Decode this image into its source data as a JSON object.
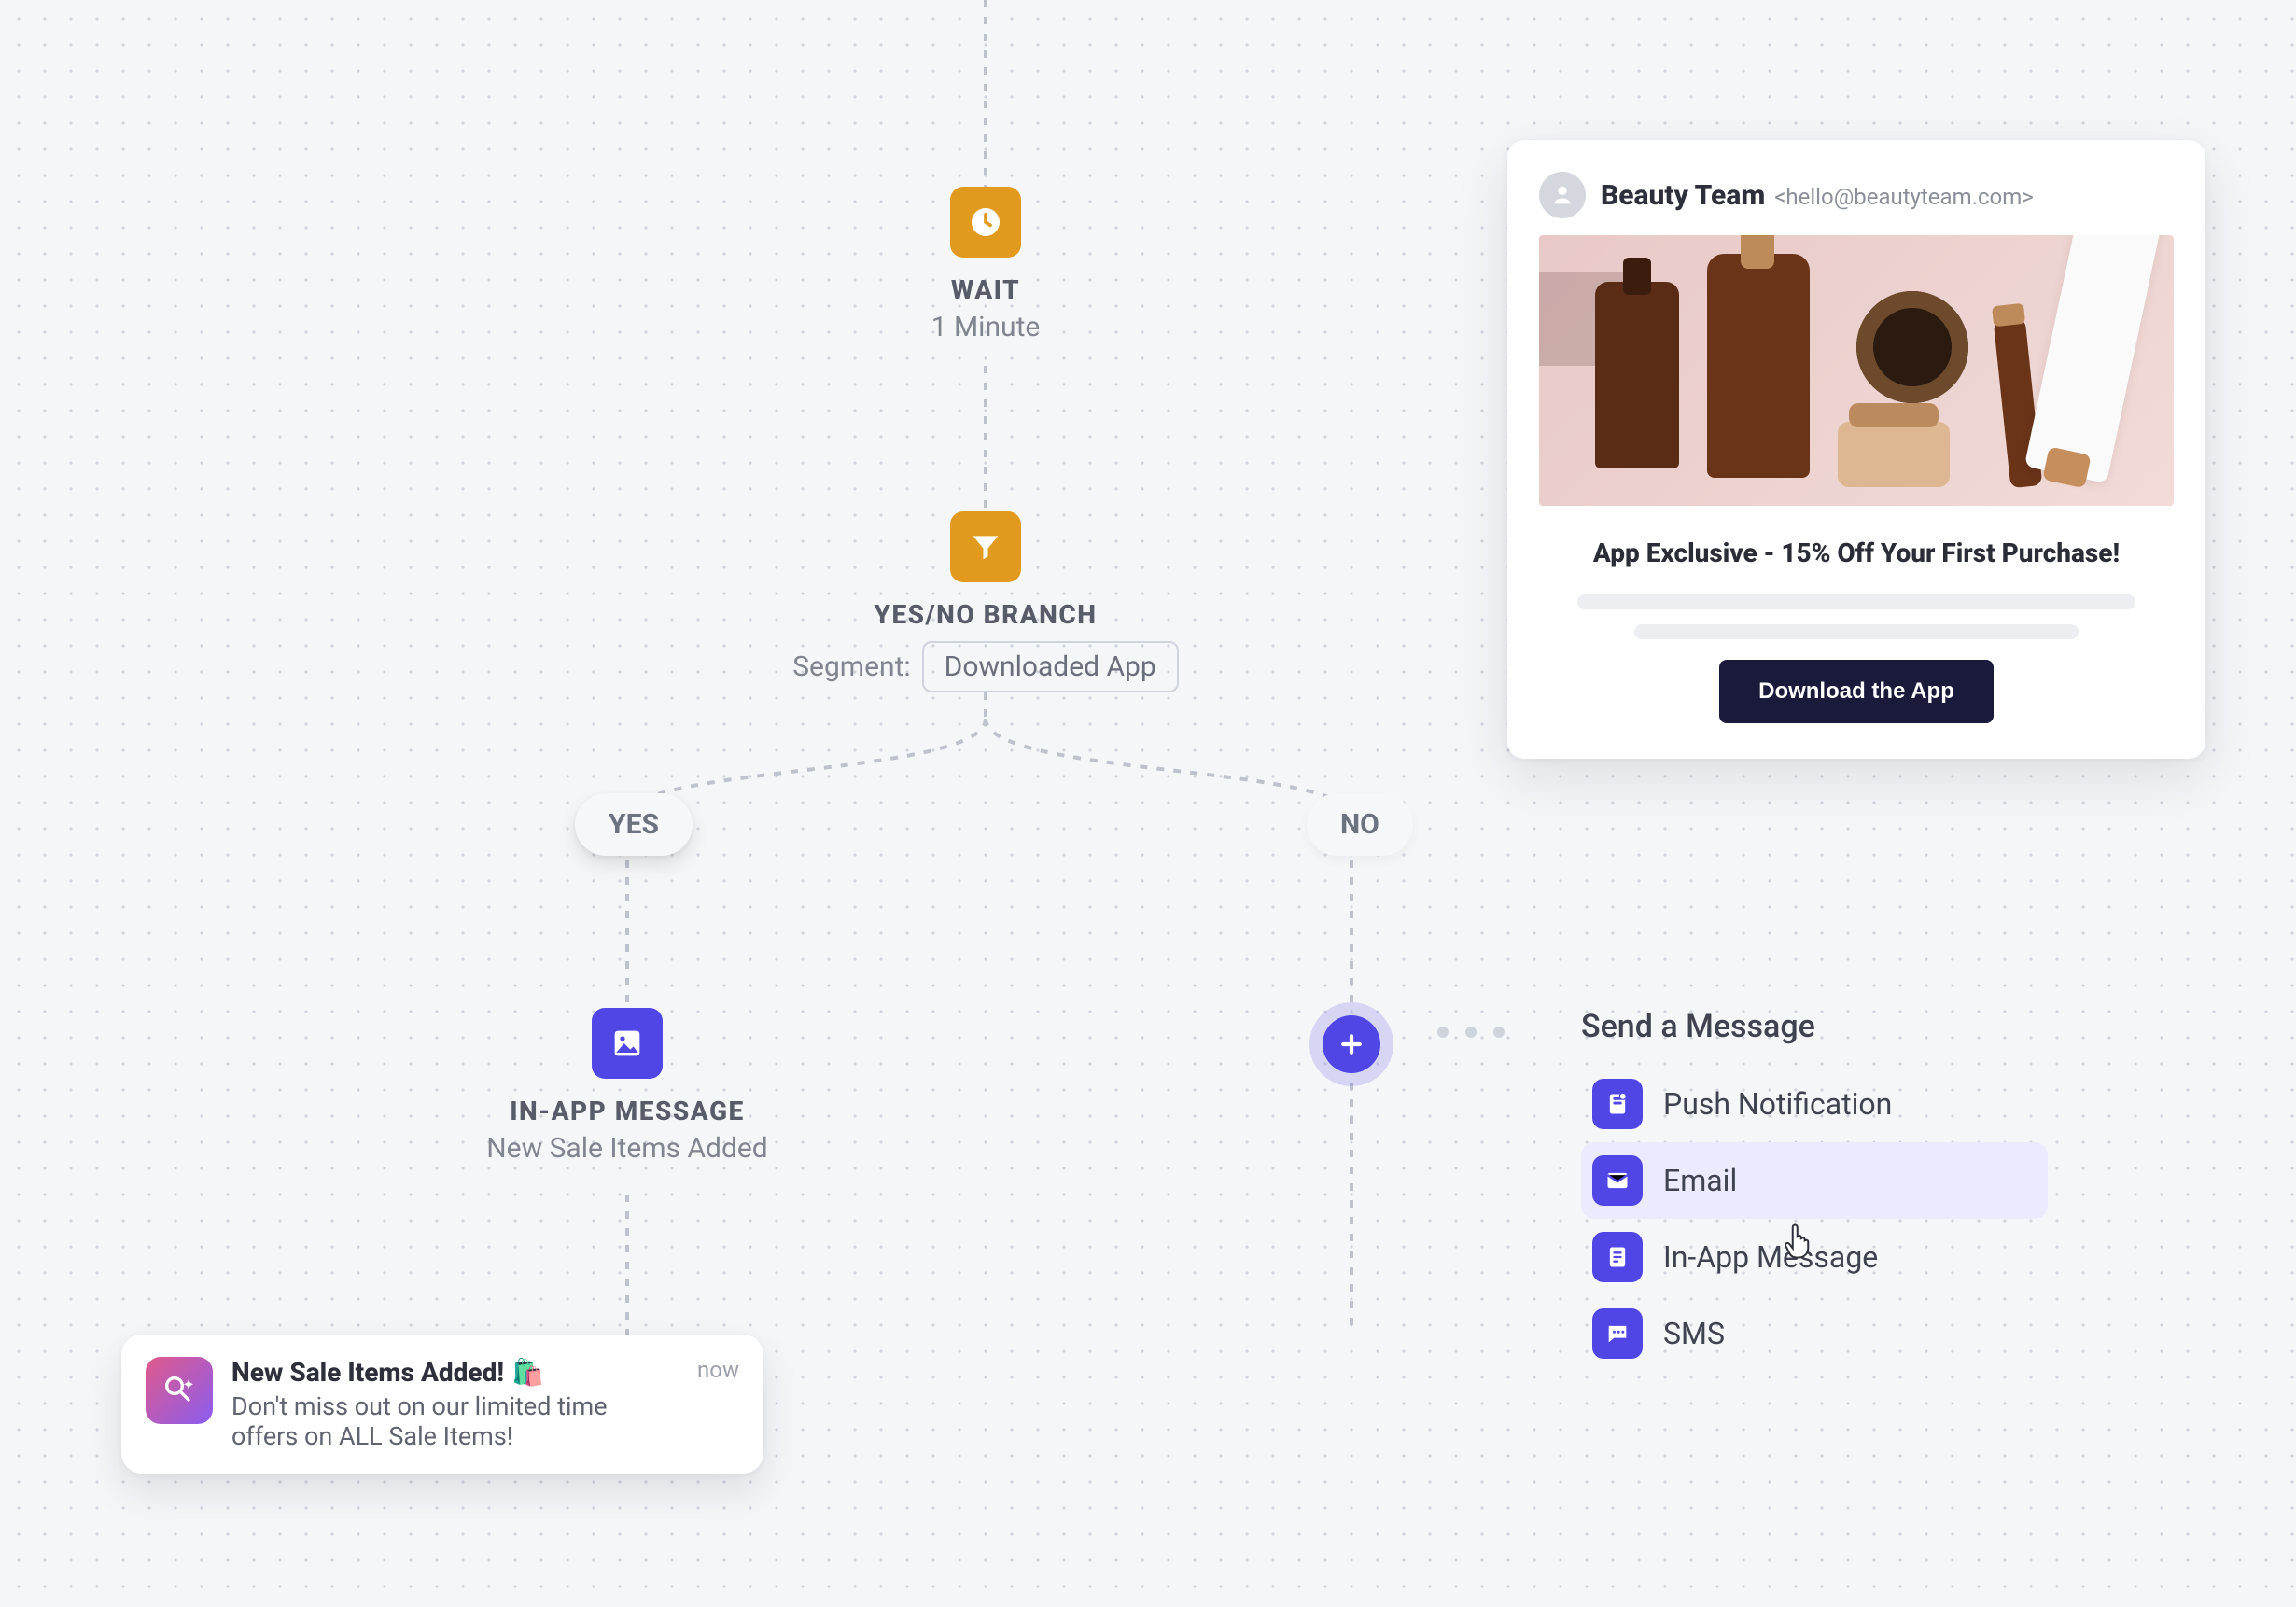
{
  "nodes": {
    "wait": {
      "title": "WAIT",
      "sub": "1 Minute"
    },
    "branch": {
      "title": "YES/NO BRANCH",
      "segment_label": "Segment:",
      "segment_value": "Downloaded App"
    },
    "inapp": {
      "title": "IN-APP MESSAGE",
      "sub": "New Sale Items Added"
    }
  },
  "pills": {
    "yes": "YES",
    "no": "NO"
  },
  "email_preview": {
    "from_name": "Beauty Team",
    "from_addr": "<hello@beautyteam.com>",
    "headline": "App Exclusive - 15% Off Your First Purchase!",
    "cta": "Download the App"
  },
  "menu": {
    "title": "Send a Message",
    "items": [
      {
        "label": "Push Notification",
        "icon": "bell-icon"
      },
      {
        "label": "Email",
        "icon": "mail-icon"
      },
      {
        "label": "In-App Message",
        "icon": "doc-icon"
      },
      {
        "label": "SMS",
        "icon": "chat-icon"
      }
    ],
    "hovered_index": 1
  },
  "toast": {
    "title": "New Sale Items Added!",
    "emoji": "🛍️",
    "body": "Don't miss out on our limited time offers on ALL Sale Items!",
    "time": "now"
  }
}
